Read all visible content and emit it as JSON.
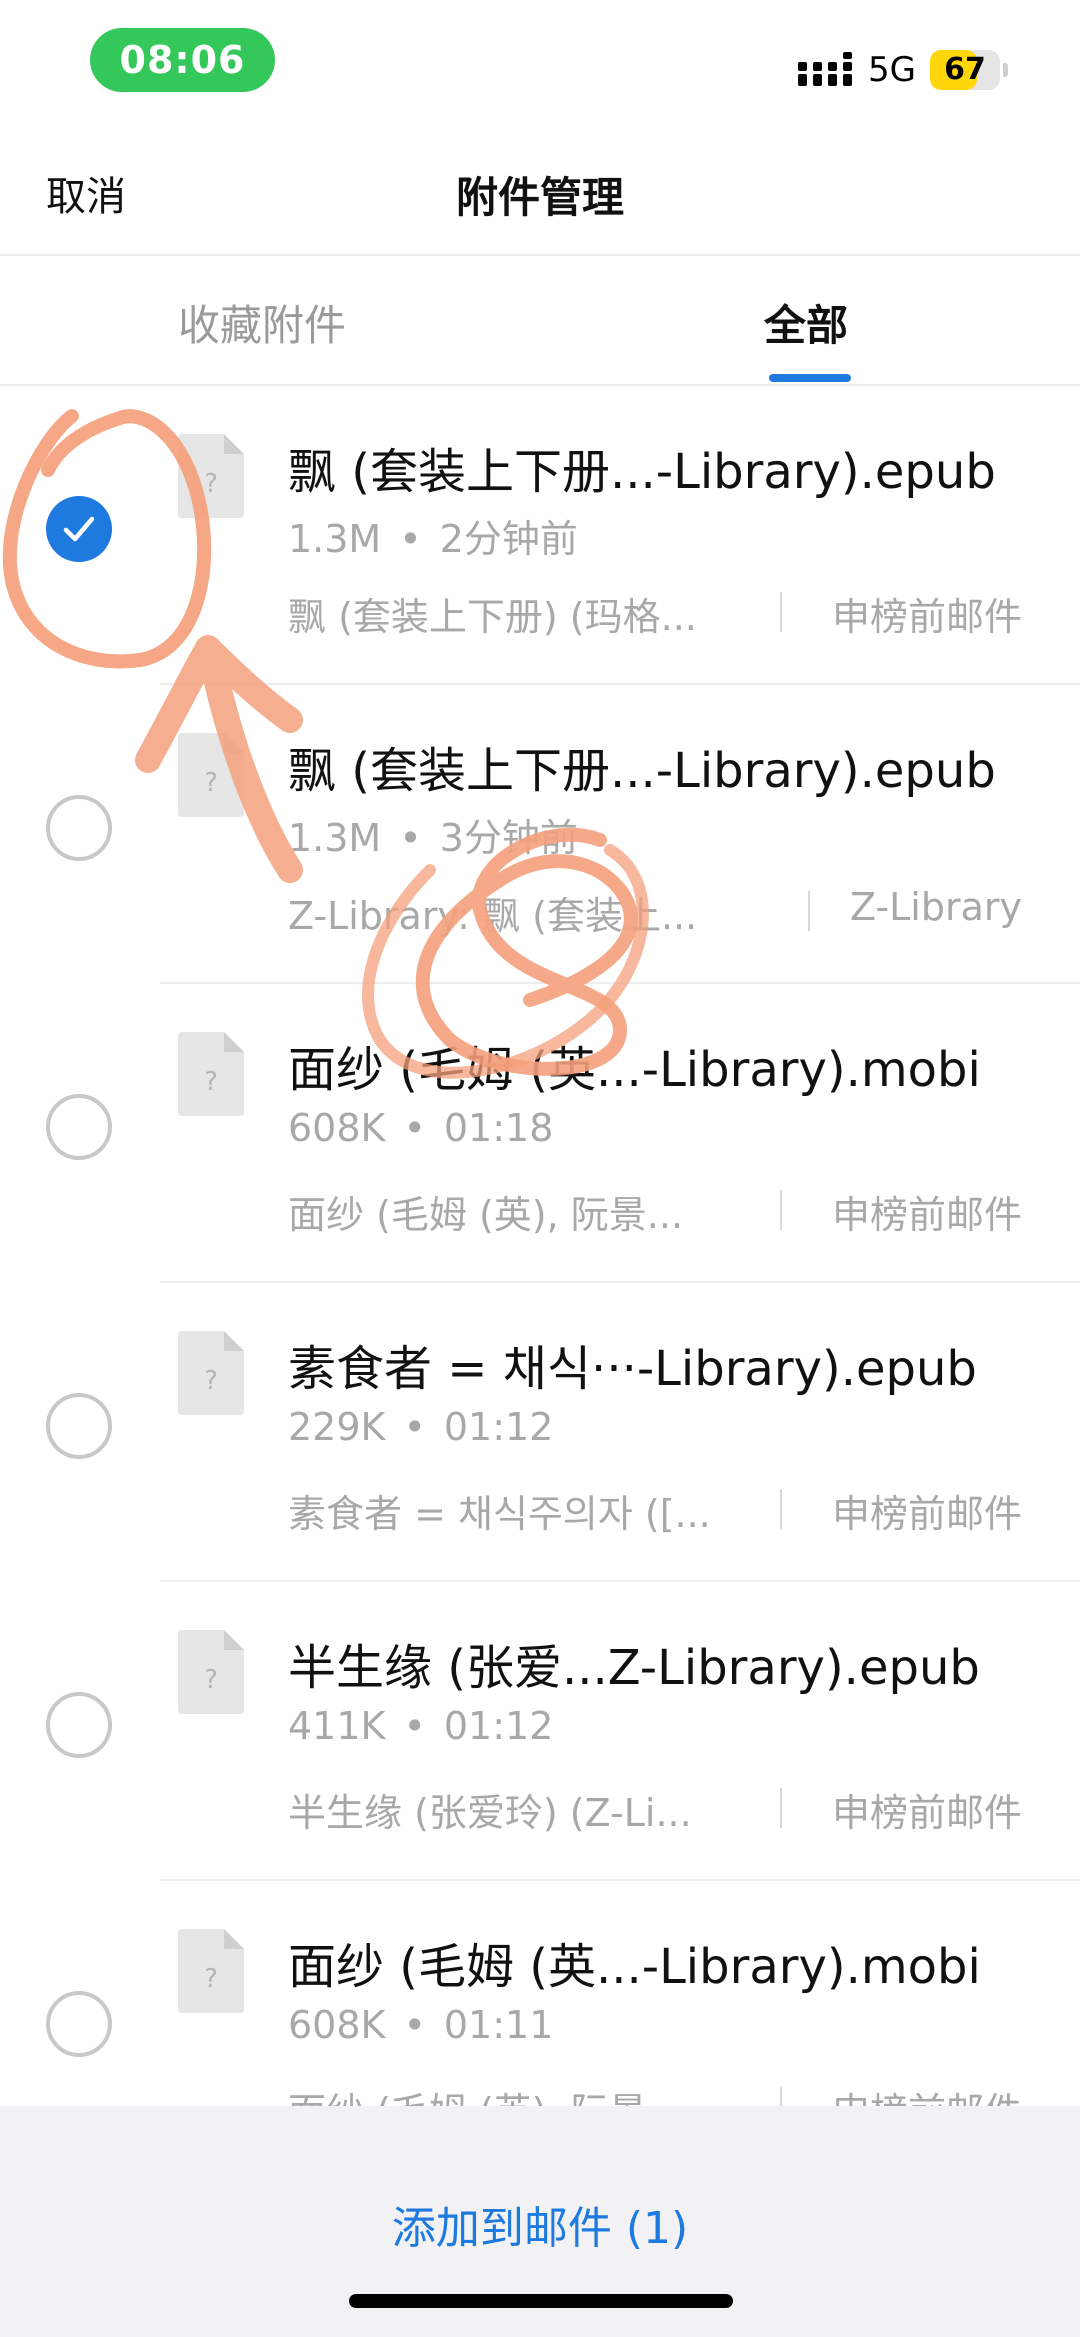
{
  "status_bar": {
    "time": "08:06",
    "network": "5G",
    "battery_level": "67",
    "battery_percent": 67
  },
  "nav": {
    "cancel_label": "取消",
    "title": "附件管理"
  },
  "tabs": [
    {
      "label": "收藏附件",
      "active": false
    },
    {
      "label": "全部",
      "active": true
    }
  ],
  "files": [
    {
      "name": "飘 (套装上下册...-Library).epub",
      "size": "1.3M",
      "time": "2分钟前",
      "subject": "飘 (套装上下册) (玛格...",
      "sender": "申榜前邮件",
      "selected": true
    },
    {
      "name": "飘 (套装上下册...-Library).epub",
      "size": "1.3M",
      "time": "3分钟前",
      "subject": "Z-Library: 飘 (套装上...",
      "sender": "Z-Library",
      "selected": false
    },
    {
      "name": "面纱 (毛姆 (英...-Library).mobi",
      "size": "608K",
      "time": "01:18",
      "subject": "面纱 (毛姆 (英), 阮景...",
      "sender": "申榜前邮件",
      "selected": false
    },
    {
      "name": "素食者 = 채식···-Library).epub",
      "size": "229K",
      "time": "01:12",
      "subject": "素食者 = 채식주의자 ([...",
      "sender": "申榜前邮件",
      "selected": false
    },
    {
      "name": "半生缘 (张爱...Z-Library).epub",
      "size": "411K",
      "time": "01:12",
      "subject": "半生缘 (张爱玲) (Z-Li...",
      "sender": "申榜前邮件",
      "selected": false
    },
    {
      "name": "面纱 (毛姆 (英...-Library).mobi",
      "size": "608K",
      "time": "01:11",
      "subject": "面纱 (毛姆 (英), 阮景...",
      "sender": "申榜前邮件",
      "selected": false
    }
  ],
  "bottom": {
    "add_label": "添加到邮件 (1)"
  },
  "colors": {
    "accent": "#1f7ae0",
    "annotation": "#f4a07c",
    "time_pill": "#34c759",
    "battery": "#ffd60a"
  },
  "icons": {
    "signal": "signal-bars-icon",
    "file": "unknown-file-icon",
    "check": "checkmark-icon"
  }
}
